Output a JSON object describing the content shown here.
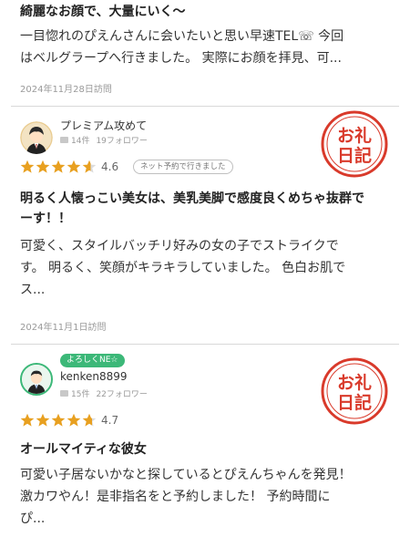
{
  "reviews": [
    {
      "title": "綺麗なお顔で、大量にいく〜",
      "body": [
        "一目惚れのぴえんさんに会いたいと思い早速TEL☏ 今回",
        "はベルグラープへ行きました。 実際にお顔を拝見、可..."
      ],
      "date": "2024年11月28日訪問"
    },
    {
      "username": "プレミアム攻めて",
      "posts": "14件",
      "followers": "19フォロワー",
      "rating": 4.6,
      "rating_text": "4.6",
      "badge": "ネット予約で行きました",
      "stamp_line1": "お礼",
      "stamp_line2": "日記",
      "title": [
        "明るく人懐っこい美女は、美乳美脚で感度良くめちゃ抜群で",
        "ーす！！"
      ],
      "body": [
        "可愛く、スタイルバッチリ好みの女の子でストライクで",
        "す。 明るく、笑顔がキラキラしていました。 色白お肌で",
        "ス..."
      ],
      "date": "2024年11月1日訪問"
    },
    {
      "rank_label": "よろしくNE☆",
      "username": "kenken8899",
      "posts": "15件",
      "followers": "22フォロワー",
      "rating": 4.7,
      "rating_text": "4.7",
      "stamp_line1": "お礼",
      "stamp_line2": "日記",
      "title": "オールマイティな彼女",
      "body": [
        "可愛い子居ないかなと探しているとぴえんちゃんを発見！",
        "激カワやん！是非指名をと予約しました！ 予約時間に",
        "ぴ..."
      ]
    }
  ],
  "colors": {
    "star": "#e8a020",
    "stamp": "#d93a2b",
    "rank_badge": "#3cb878"
  },
  "icons": {
    "star": "star-icon",
    "avatar": "user-avatar-icon",
    "post": "post-icon"
  }
}
